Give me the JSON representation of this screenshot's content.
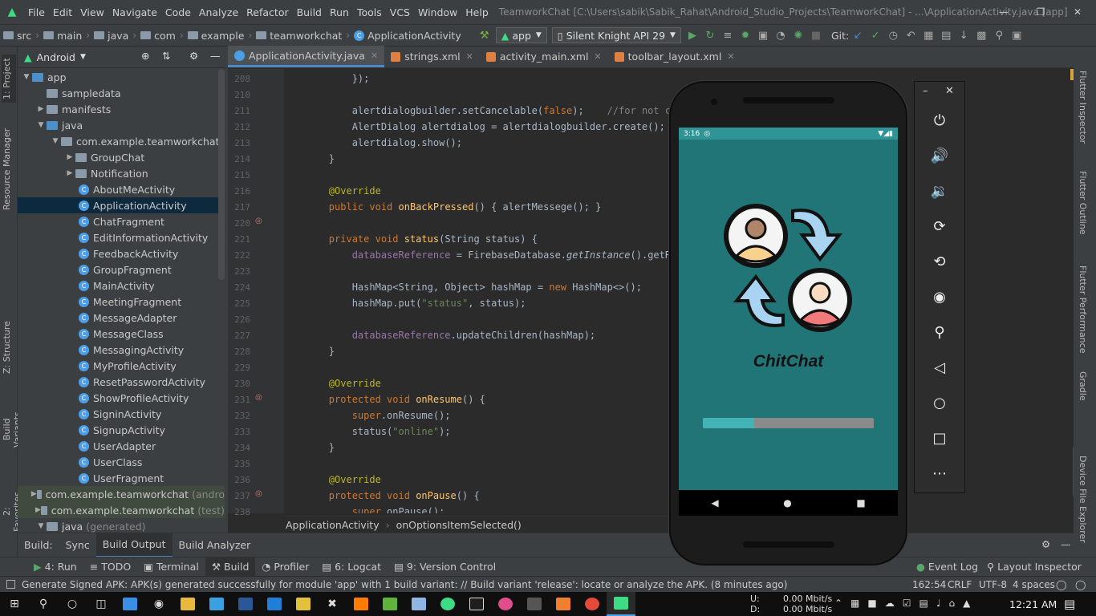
{
  "menubar": {
    "items": [
      "File",
      "Edit",
      "View",
      "Navigate",
      "Code",
      "Analyze",
      "Refactor",
      "Build",
      "Run",
      "Tools",
      "VCS",
      "Window",
      "Help"
    ],
    "title": "TeamworkChat [C:\\Users\\sabik\\Sabik_Rahat\\Android_Studio_Projects\\TeamworkChat] - ...\\ApplicationActivity.java [app]"
  },
  "navbar": {
    "crumbs": [
      "src",
      "main",
      "java",
      "com",
      "example",
      "teamworkchat",
      "ApplicationActivity"
    ],
    "run_config": "app",
    "device": "Silent Knight  API 29",
    "git_label": "Git:"
  },
  "sidebar_tabs": {
    "project": "1: Project",
    "resource_manager": "Resource Manager",
    "structure": "Z: Structure",
    "build_variants": "Build Variants",
    "favorites": "2: Favorites"
  },
  "right_tabs": {
    "flutter_inspector": "Flutter Inspector",
    "flutter_outline": "Flutter Outline",
    "flutter_performance": "Flutter Performance",
    "gradle": "Gradle",
    "device_file_explorer": "Device File Explorer"
  },
  "project": {
    "view": "Android",
    "tree": [
      {
        "label": "app",
        "depth": 0,
        "kind": "module",
        "arrow": "down"
      },
      {
        "label": "sampledata",
        "depth": 1,
        "kind": "folder",
        "arrow": ""
      },
      {
        "label": "manifests",
        "depth": 1,
        "kind": "folder",
        "arrow": "right"
      },
      {
        "label": "java",
        "depth": 1,
        "kind": "folder-blue",
        "arrow": "down"
      },
      {
        "label": "com.example.teamworkchat",
        "depth": 2,
        "kind": "folder",
        "arrow": "down"
      },
      {
        "label": "GroupChat",
        "depth": 3,
        "kind": "folder",
        "arrow": "right"
      },
      {
        "label": "Notification",
        "depth": 3,
        "kind": "folder",
        "arrow": "right"
      },
      {
        "label": "AboutMeActivity",
        "depth": 4,
        "kind": "class"
      },
      {
        "label": "ApplicationActivity",
        "depth": 4,
        "kind": "class",
        "selected": true
      },
      {
        "label": "ChatFragment",
        "depth": 4,
        "kind": "class"
      },
      {
        "label": "EditInformationActivity",
        "depth": 4,
        "kind": "class"
      },
      {
        "label": "FeedbackActivity",
        "depth": 4,
        "kind": "class"
      },
      {
        "label": "GroupFragment",
        "depth": 4,
        "kind": "class"
      },
      {
        "label": "MainActivity",
        "depth": 4,
        "kind": "class"
      },
      {
        "label": "MeetingFragment",
        "depth": 4,
        "kind": "class"
      },
      {
        "label": "MessageAdapter",
        "depth": 4,
        "kind": "class"
      },
      {
        "label": "MessageClass",
        "depth": 4,
        "kind": "class"
      },
      {
        "label": "MessagingActivity",
        "depth": 4,
        "kind": "class"
      },
      {
        "label": "MyProfileActivity",
        "depth": 4,
        "kind": "class"
      },
      {
        "label": "ResetPasswordActivity",
        "depth": 4,
        "kind": "class"
      },
      {
        "label": "ShowProfileActivity",
        "depth": 4,
        "kind": "class"
      },
      {
        "label": "SigninActivity",
        "depth": 4,
        "kind": "class"
      },
      {
        "label": "SignupActivity",
        "depth": 4,
        "kind": "class"
      },
      {
        "label": "UserAdapter",
        "depth": 4,
        "kind": "class"
      },
      {
        "label": "UserClass",
        "depth": 4,
        "kind": "class"
      },
      {
        "label": "UserFragment",
        "depth": 4,
        "kind": "class"
      },
      {
        "label": "com.example.teamworkchat",
        "suffix": "(andro",
        "depth": 2,
        "kind": "folder",
        "arrow": "right",
        "gen": true
      },
      {
        "label": "com.example.teamworkchat",
        "suffix": "(test)",
        "depth": 2,
        "kind": "folder",
        "arrow": "right",
        "gen": true
      },
      {
        "label": "java",
        "suffix": "(generated)",
        "depth": 1,
        "kind": "folder",
        "arrow": "down"
      }
    ]
  },
  "tabs": [
    {
      "label": "ApplicationActivity.java",
      "kind": "java",
      "active": true
    },
    {
      "label": "strings.xml",
      "kind": "xml"
    },
    {
      "label": "activity_main.xml",
      "kind": "xml"
    },
    {
      "label": "toolbar_layout.xml",
      "kind": "xml"
    }
  ],
  "code_lines": [
    {
      "n": "208",
      "html": "            });"
    },
    {
      "n": "210",
      "html": ""
    },
    {
      "n": "211",
      "html": "            alertdialogbuilder.setCancelable(<span class='kw'>false</span>);    <span class='cm'>//for not cancel</span>"
    },
    {
      "n": "212",
      "html": "            AlertDialog alertdialog = alertdialogbuilder.create();"
    },
    {
      "n": "213",
      "html": "            alertdialog.show();"
    },
    {
      "n": "214",
      "html": "        }"
    },
    {
      "n": "215",
      "html": ""
    },
    {
      "n": "216",
      "html": "        <span class='an'>@Override</span>"
    },
    {
      "n": "217",
      "html": "        <span class='kw'>public void</span> <span class='fn'>onBackPressed</span>() { alertMessege(); }"
    },
    {
      "n": "220",
      "html": ""
    },
    {
      "n": "221",
      "html": "        <span class='kw'>private void</span> <span class='fn'>status</span>(String status) {"
    },
    {
      "n": "222",
      "html": "            <span class='fd'>databaseReference</span> = FirebaseDatabase.<span class='it'>getInstance</span>().getReferen"
    },
    {
      "n": "223",
      "html": ""
    },
    {
      "n": "224",
      "html": "            HashMap&lt;String, Object&gt; hashMap = <span class='kw'>new</span> HashMap&lt;&gt;();"
    },
    {
      "n": "225",
      "html": "            hashMap.put(<span class='st'>\"status\"</span>, status);"
    },
    {
      "n": "226",
      "html": ""
    },
    {
      "n": "227",
      "html": "            <span class='fd'>databaseReference</span>.updateChildren(hashMap);"
    },
    {
      "n": "228",
      "html": "        }"
    },
    {
      "n": "229",
      "html": ""
    },
    {
      "n": "230",
      "html": "        <span class='an'>@Override</span>"
    },
    {
      "n": "231",
      "html": "        <span class='kw'>protected void</span> <span class='fn'>onResume</span>() {"
    },
    {
      "n": "232",
      "html": "            <span class='kw'>super</span>.onResume();"
    },
    {
      "n": "233",
      "html": "            status(<span class='st'>\"online\"</span>);"
    },
    {
      "n": "234",
      "html": "        }"
    },
    {
      "n": "235",
      "html": ""
    },
    {
      "n": "236",
      "html": "        <span class='an'>@Override</span>"
    },
    {
      "n": "237",
      "html": "        <span class='kw'>protected void</span> <span class='fn'>onPause</span>() {"
    },
    {
      "n": "238",
      "html": "            <span class='kw'>super</span>.onPause();"
    }
  ],
  "editor_breadcrumb": [
    "ApplicationActivity",
    "onOptionsItemSelected()"
  ],
  "build_bar": {
    "label": "Build:",
    "sync": "Sync",
    "output": "Build Output",
    "analyzer": "Build Analyzer"
  },
  "tool_windows": [
    "4: Run",
    "TODO",
    "Terminal",
    "Build",
    "Profiler",
    "6: Logcat",
    "9: Version Control"
  ],
  "tool_windows_right": [
    "Event Log",
    "Layout Inspector"
  ],
  "status": {
    "message": "Generate Signed APK: APK(s) generated successfully for module 'app' with 1 build variant: // Build variant 'release': locate or analyze the APK. (8 minutes ago)",
    "position": "162:54",
    "line_sep": "CRLF",
    "encoding": "UTF-8",
    "indent": "4 spaces"
  },
  "emulator": {
    "time": "3:16",
    "app_name": "ChitChat",
    "progress": 0.3,
    "accent": "#2f9496"
  },
  "taskbar": {
    "net_up_label": "U:",
    "net_down_label": "D:",
    "net_up": "0.00 Mbit/s",
    "net_down": "0.00 Mbit/s",
    "clock": "12:21 AM"
  }
}
